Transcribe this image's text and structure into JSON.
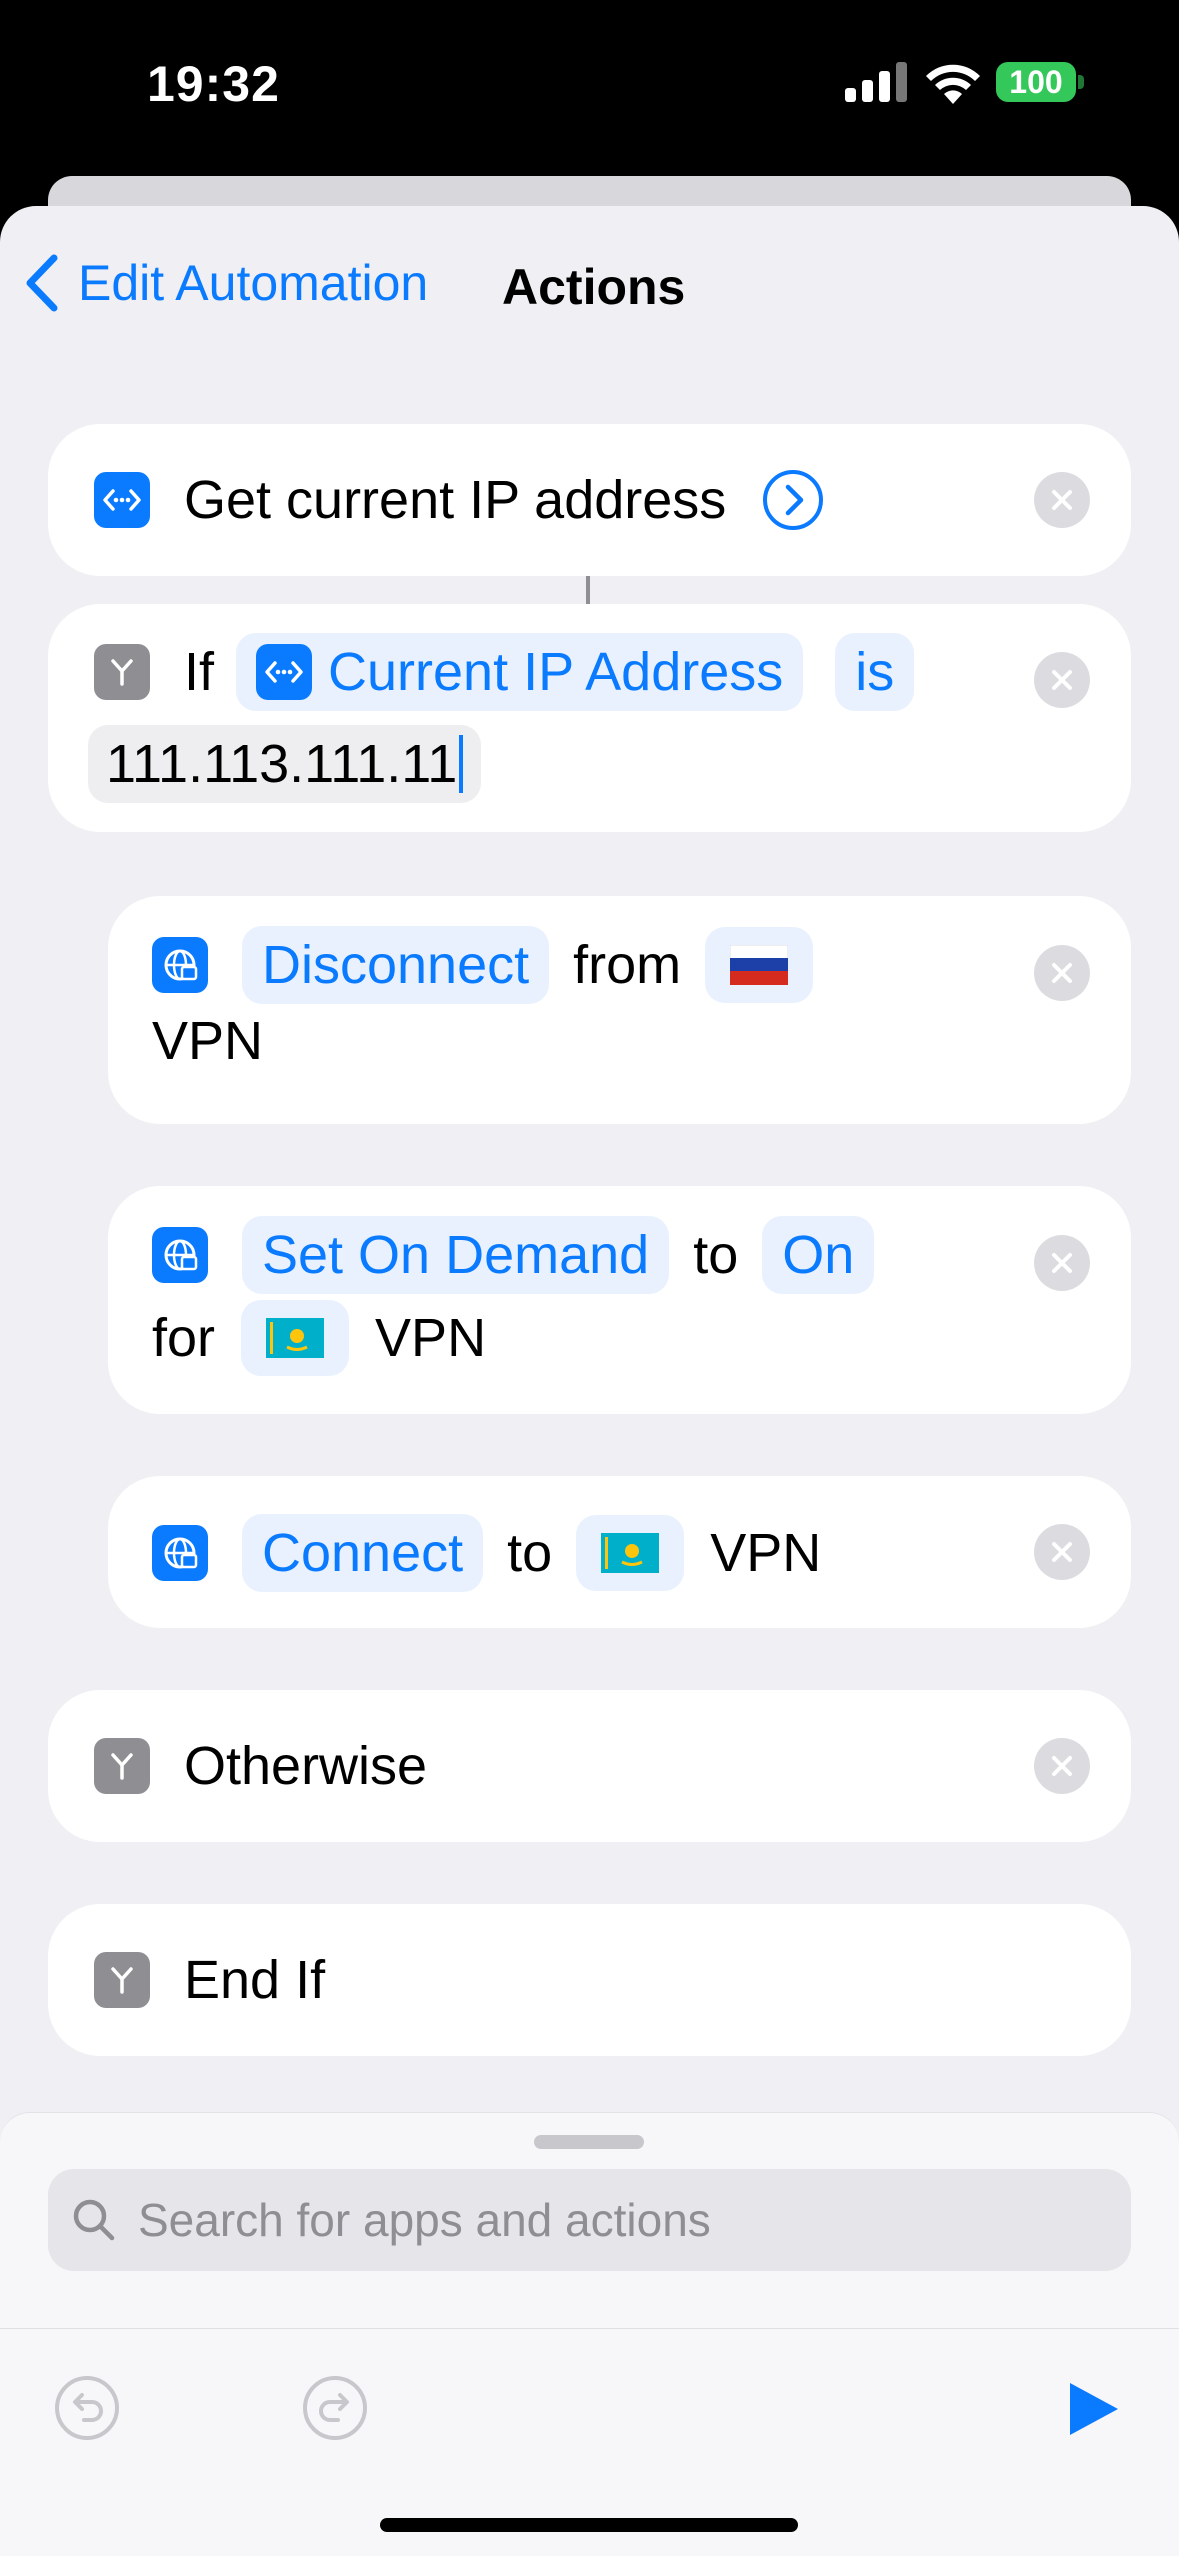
{
  "status_bar": {
    "time": "19:32",
    "battery": "100"
  },
  "nav": {
    "back_label": "Edit Automation",
    "title": "Actions"
  },
  "actions": {
    "get_ip": {
      "label": "Get current IP address"
    },
    "if_block": {
      "keyword": "If",
      "variable": "Current IP Address",
      "operator": "is",
      "value": "111.113.111.11"
    },
    "disconnect": {
      "verb": "Disconnect",
      "word_from": "from",
      "flag": "🇷🇺",
      "word_vpn": "VPN"
    },
    "set_on_demand": {
      "verb": "Set On Demand",
      "word_to": "to",
      "state": "On",
      "word_for": "for",
      "flag": "🇰🇿",
      "word_vpn": "VPN"
    },
    "connect": {
      "verb": "Connect",
      "word_to": "to",
      "flag": "🇰🇿",
      "word_vpn": "VPN"
    },
    "otherwise": {
      "label": "Otherwise"
    },
    "end_if": {
      "label": "End If"
    }
  },
  "search": {
    "placeholder": "Search for apps and actions"
  },
  "toolbar": {
    "undo": "undo-icon",
    "redo": "redo-icon",
    "run": "play-icon"
  },
  "colors": {
    "accent": "#0a7aff",
    "battery": "#34c759",
    "background": "#efeff4"
  }
}
